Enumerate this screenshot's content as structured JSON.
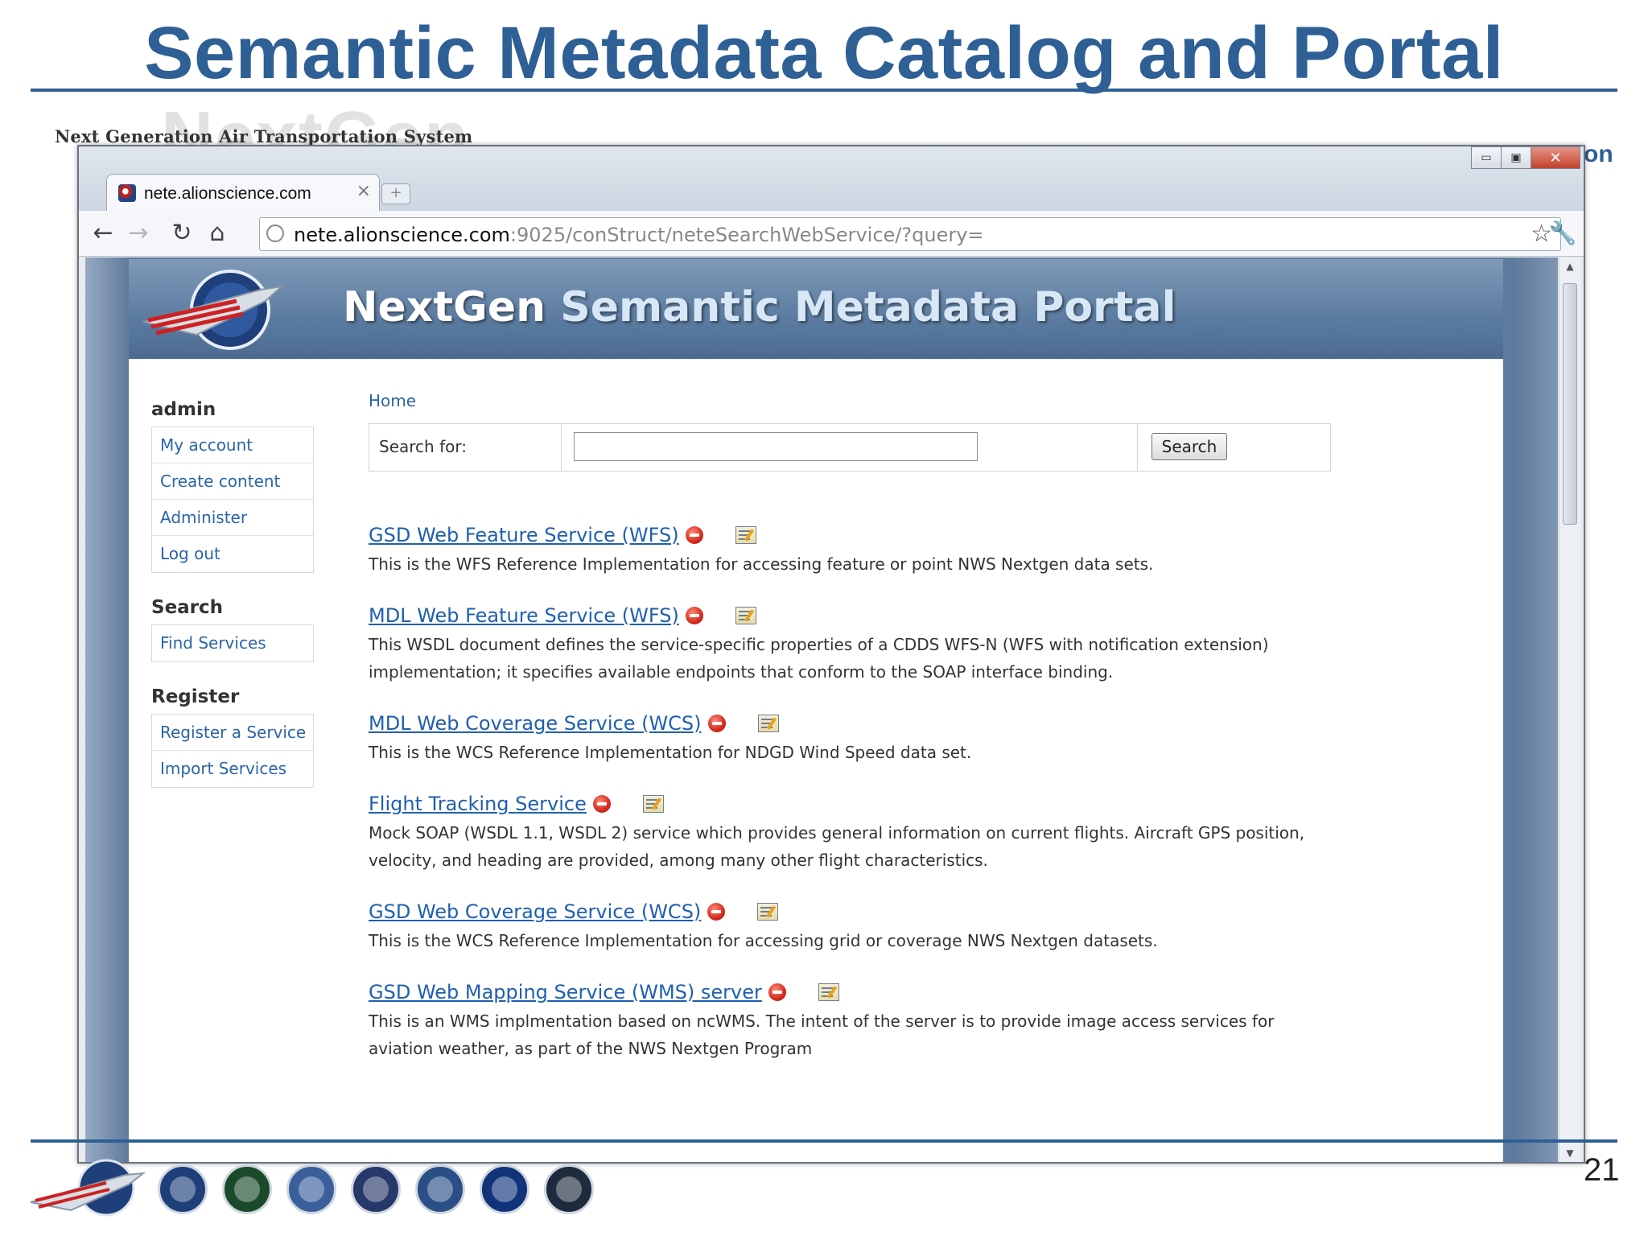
{
  "slide": {
    "title": "Semantic Metadata Catalog and Portal",
    "subtitle": "Next Generation Air Transportation System",
    "bg_ghost": "NextGen",
    "right_fragment": "on",
    "page_number": "21"
  },
  "browser": {
    "tab_title": "nete.alionscience.com",
    "tab_close": "×",
    "new_tab": "+",
    "url_domain": "nete.alionscience.com",
    "url_path": ":9025/conStruct/neteSearchWebService/?query=",
    "window_controls": {
      "minimize": "▭",
      "maximize": "▣",
      "close": "✕"
    }
  },
  "portal": {
    "banner_title_part1": "NextGen ",
    "banner_title_part2": "Semantic Metadata Portal",
    "breadcrumb": "Home",
    "search": {
      "label": "Search for:",
      "value": "",
      "button": "Search"
    }
  },
  "sidebar": {
    "admin_heading": "admin",
    "admin_items": [
      "My account",
      "Create content",
      "Administer",
      "Log out"
    ],
    "search_heading": "Search",
    "search_items": [
      "Find Services"
    ],
    "register_heading": "Register",
    "register_items": [
      "Register a Service",
      "Import Services"
    ]
  },
  "results": [
    {
      "title": "GSD Web Feature Service (WFS)",
      "desc": "This is the WFS Reference Implementation for accessing feature or point NWS Nextgen data sets."
    },
    {
      "title": "MDL Web Feature Service (WFS)",
      "desc": "This WSDL document defines the service-specific properties of a CDDS WFS-N (WFS with notification extension) implementation; it specifies available endpoints that conform to the SOAP interface binding."
    },
    {
      "title": "MDL Web Coverage Service (WCS)",
      "desc": "This is the WCS Reference Implementation for NDGD Wind Speed data set."
    },
    {
      "title": "Flight Tracking Service",
      "desc": "Mock SOAP (WSDL 1.1, WSDL 2) service which provides general information on current flights. Aircraft GPS position, velocity, and heading are provided, among many other flight characteristics."
    },
    {
      "title": "GSD Web Coverage Service (WCS)",
      "desc": "This is the WCS Reference Implementation for accessing grid or coverage NWS Nextgen datasets."
    },
    {
      "title": "GSD Web Mapping Service (WMS) server",
      "desc": "This is an WMS implmentation based on ncWMS. The intent of the server is to provide image access services for aviation weather, as part of the NWS Nextgen Program"
    }
  ],
  "colors": {
    "title_blue": "#2e5f95",
    "link_blue": "#1f5fb2",
    "banner_blue": "#5b7ba0",
    "seal_colors": [
      "#1f3f7a",
      "#1b4a2a",
      "#3a5f9a",
      "#27386b",
      "#2a4f86",
      "#10337a",
      "#1e2b3d"
    ]
  },
  "icons": [
    "back-icon",
    "forward-icon",
    "reload-icon",
    "home-icon",
    "page-icon",
    "bookmark-star-icon",
    "wrench-icon",
    "delete-icon",
    "edit-icon"
  ]
}
